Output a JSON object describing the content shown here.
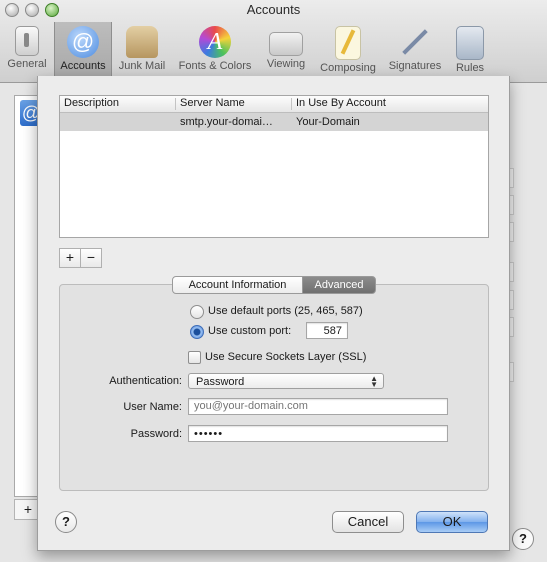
{
  "window": {
    "title": "Accounts"
  },
  "toolbar": {
    "items": [
      {
        "label": "General",
        "icon": "general-switch-icon"
      },
      {
        "label": "Accounts",
        "icon": "at-sign-icon",
        "selected": true
      },
      {
        "label": "Junk Mail",
        "icon": "junk-mail-bag-icon"
      },
      {
        "label": "Fonts & Colors",
        "icon": "fonts-colors-icon"
      },
      {
        "label": "Viewing",
        "icon": "viewing-glasses-icon"
      },
      {
        "label": "Composing",
        "icon": "composing-pencil-icon"
      },
      {
        "label": "Signatures",
        "icon": "signature-pen-icon"
      },
      {
        "label": "Rules",
        "icon": "rules-arrows-icon"
      }
    ]
  },
  "background": {
    "add_symbol": "+",
    "help_symbol": "?"
  },
  "smtp_sheet": {
    "columns": [
      "Description",
      "Server Name",
      "In Use By Account"
    ],
    "rows": [
      {
        "description": "",
        "server_name": "smtp.your-domai…",
        "in_use_by": "Your-Domain"
      }
    ],
    "add_symbol": "+",
    "remove_symbol": "−",
    "tabs": [
      "Account Information",
      "Advanced"
    ],
    "selected_tab": "Advanced",
    "advanced": {
      "default_ports_label": "Use default ports (25, 465, 587)",
      "custom_port_label": "Use custom port:",
      "custom_port_value": "587",
      "port_mode": "custom",
      "ssl_label": "Use Secure Sockets Layer (SSL)",
      "ssl_checked": false,
      "authentication_label": "Authentication:",
      "authentication_value": "Password",
      "user_name_label": "User Name:",
      "user_name_placeholder": "you@your-domain.com",
      "password_label": "Password:",
      "password_value": "••••••"
    },
    "help_symbol": "?",
    "cancel_label": "Cancel",
    "ok_label": "OK"
  },
  "colors": {
    "selection_blue": "#5d97e6",
    "row_highlight": "#d4d4d4"
  }
}
